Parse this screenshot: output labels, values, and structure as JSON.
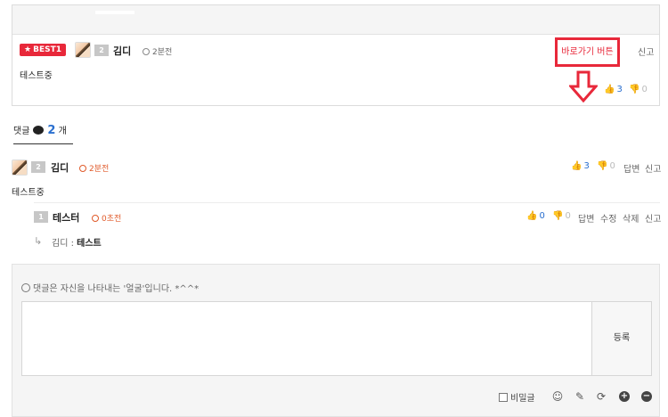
{
  "best_comment": {
    "badge": "BEST1",
    "level": "2",
    "username": "김디",
    "time": "2분전",
    "body": "테스트중",
    "report_label": "신고",
    "upvotes": "3",
    "downvotes": "0"
  },
  "annotation": {
    "label": "바로가기 버튼",
    "color": "#e8283a"
  },
  "comments_header": {
    "label": "댓글",
    "count": "2",
    "unit": "개"
  },
  "comments": [
    {
      "level": "2",
      "username": "김디",
      "time": "2분전",
      "body": "테스트중",
      "upvotes": "3",
      "downvotes": "0",
      "actions": [
        "답변",
        "신고"
      ]
    },
    {
      "level": "1",
      "username": "테스터",
      "time": "0초전",
      "upvotes": "0",
      "downvotes": "0",
      "actions": [
        "답변",
        "수정",
        "삭제",
        "신고"
      ],
      "reply_to": "김디",
      "reply_body": "테스트"
    }
  ],
  "write_form": {
    "notice": "댓글은 자신을 나타내는 '얼굴'입니다. *^^*",
    "submit_label": "등록",
    "secret_label": "비밀글",
    "icons": [
      "smile-icon",
      "pencil-icon",
      "refresh-icon",
      "plus-icon",
      "minus-icon"
    ]
  },
  "colors": {
    "accent_blue": "#2a6fcf",
    "badge_red": "#e8283a",
    "time_orange": "#e05a2a"
  }
}
